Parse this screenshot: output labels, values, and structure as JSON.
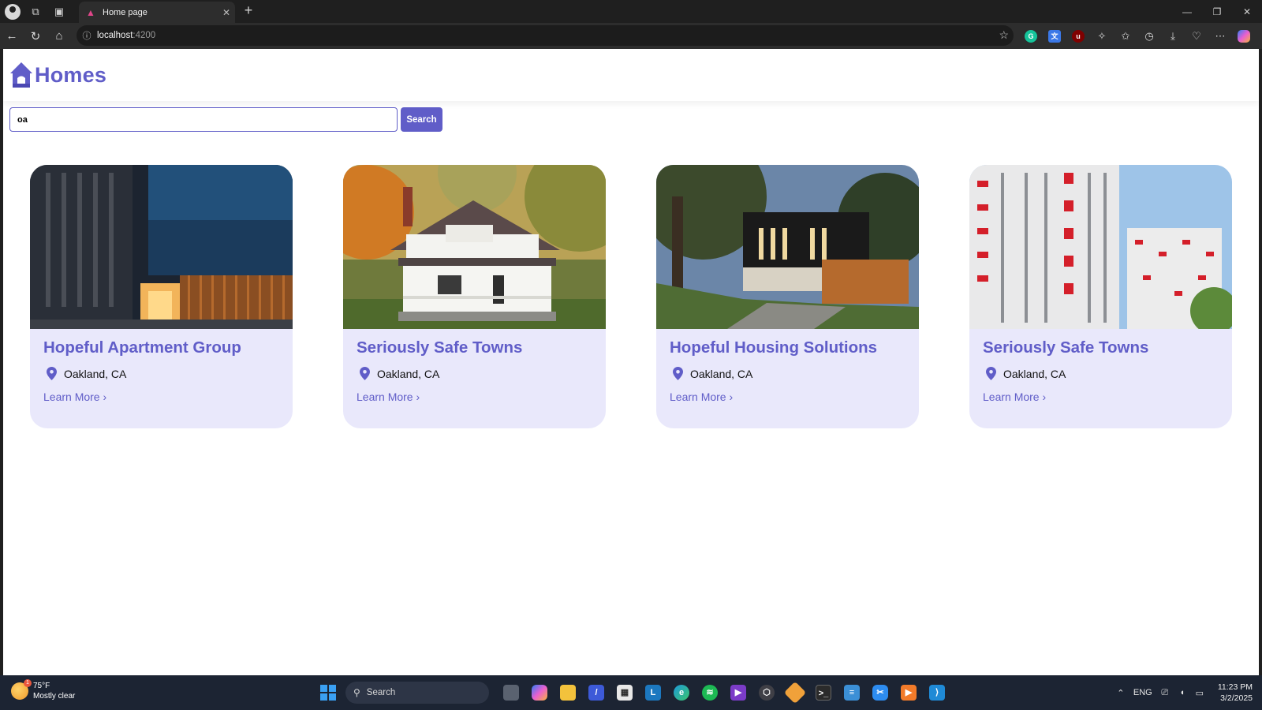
{
  "browser": {
    "tab_title": "Home page",
    "url_host": "localhost",
    "url_port": ":4200"
  },
  "app": {
    "brand": "Homes",
    "brand_color": "#605dc8",
    "search": {
      "value": "oa",
      "button_label": "Search"
    },
    "listings": [
      {
        "name": "Hopeful Apartment Group",
        "location": "Oakland, CA",
        "link_label": "Learn More ›",
        "photo": "modern-dark-apartment"
      },
      {
        "name": "Seriously Safe Towns",
        "location": "Oakland, CA",
        "link_label": "Learn More ›",
        "photo": "white-house-autumn"
      },
      {
        "name": "Hopeful Housing Solutions",
        "location": "Oakland, CA",
        "link_label": "Learn More ›",
        "photo": "modern-black-house-trees"
      },
      {
        "name": "Seriously Safe Towns",
        "location": "Oakland, CA",
        "link_label": "Learn More ›",
        "photo": "red-white-apartment-towers"
      }
    ]
  },
  "taskbar": {
    "weather_temp": "75°F",
    "weather_desc": "Mostly clear",
    "weather_badge": "1",
    "search_label": "Search",
    "language": "ENG",
    "time": "11:23 PM",
    "date": "3/2/2025"
  }
}
